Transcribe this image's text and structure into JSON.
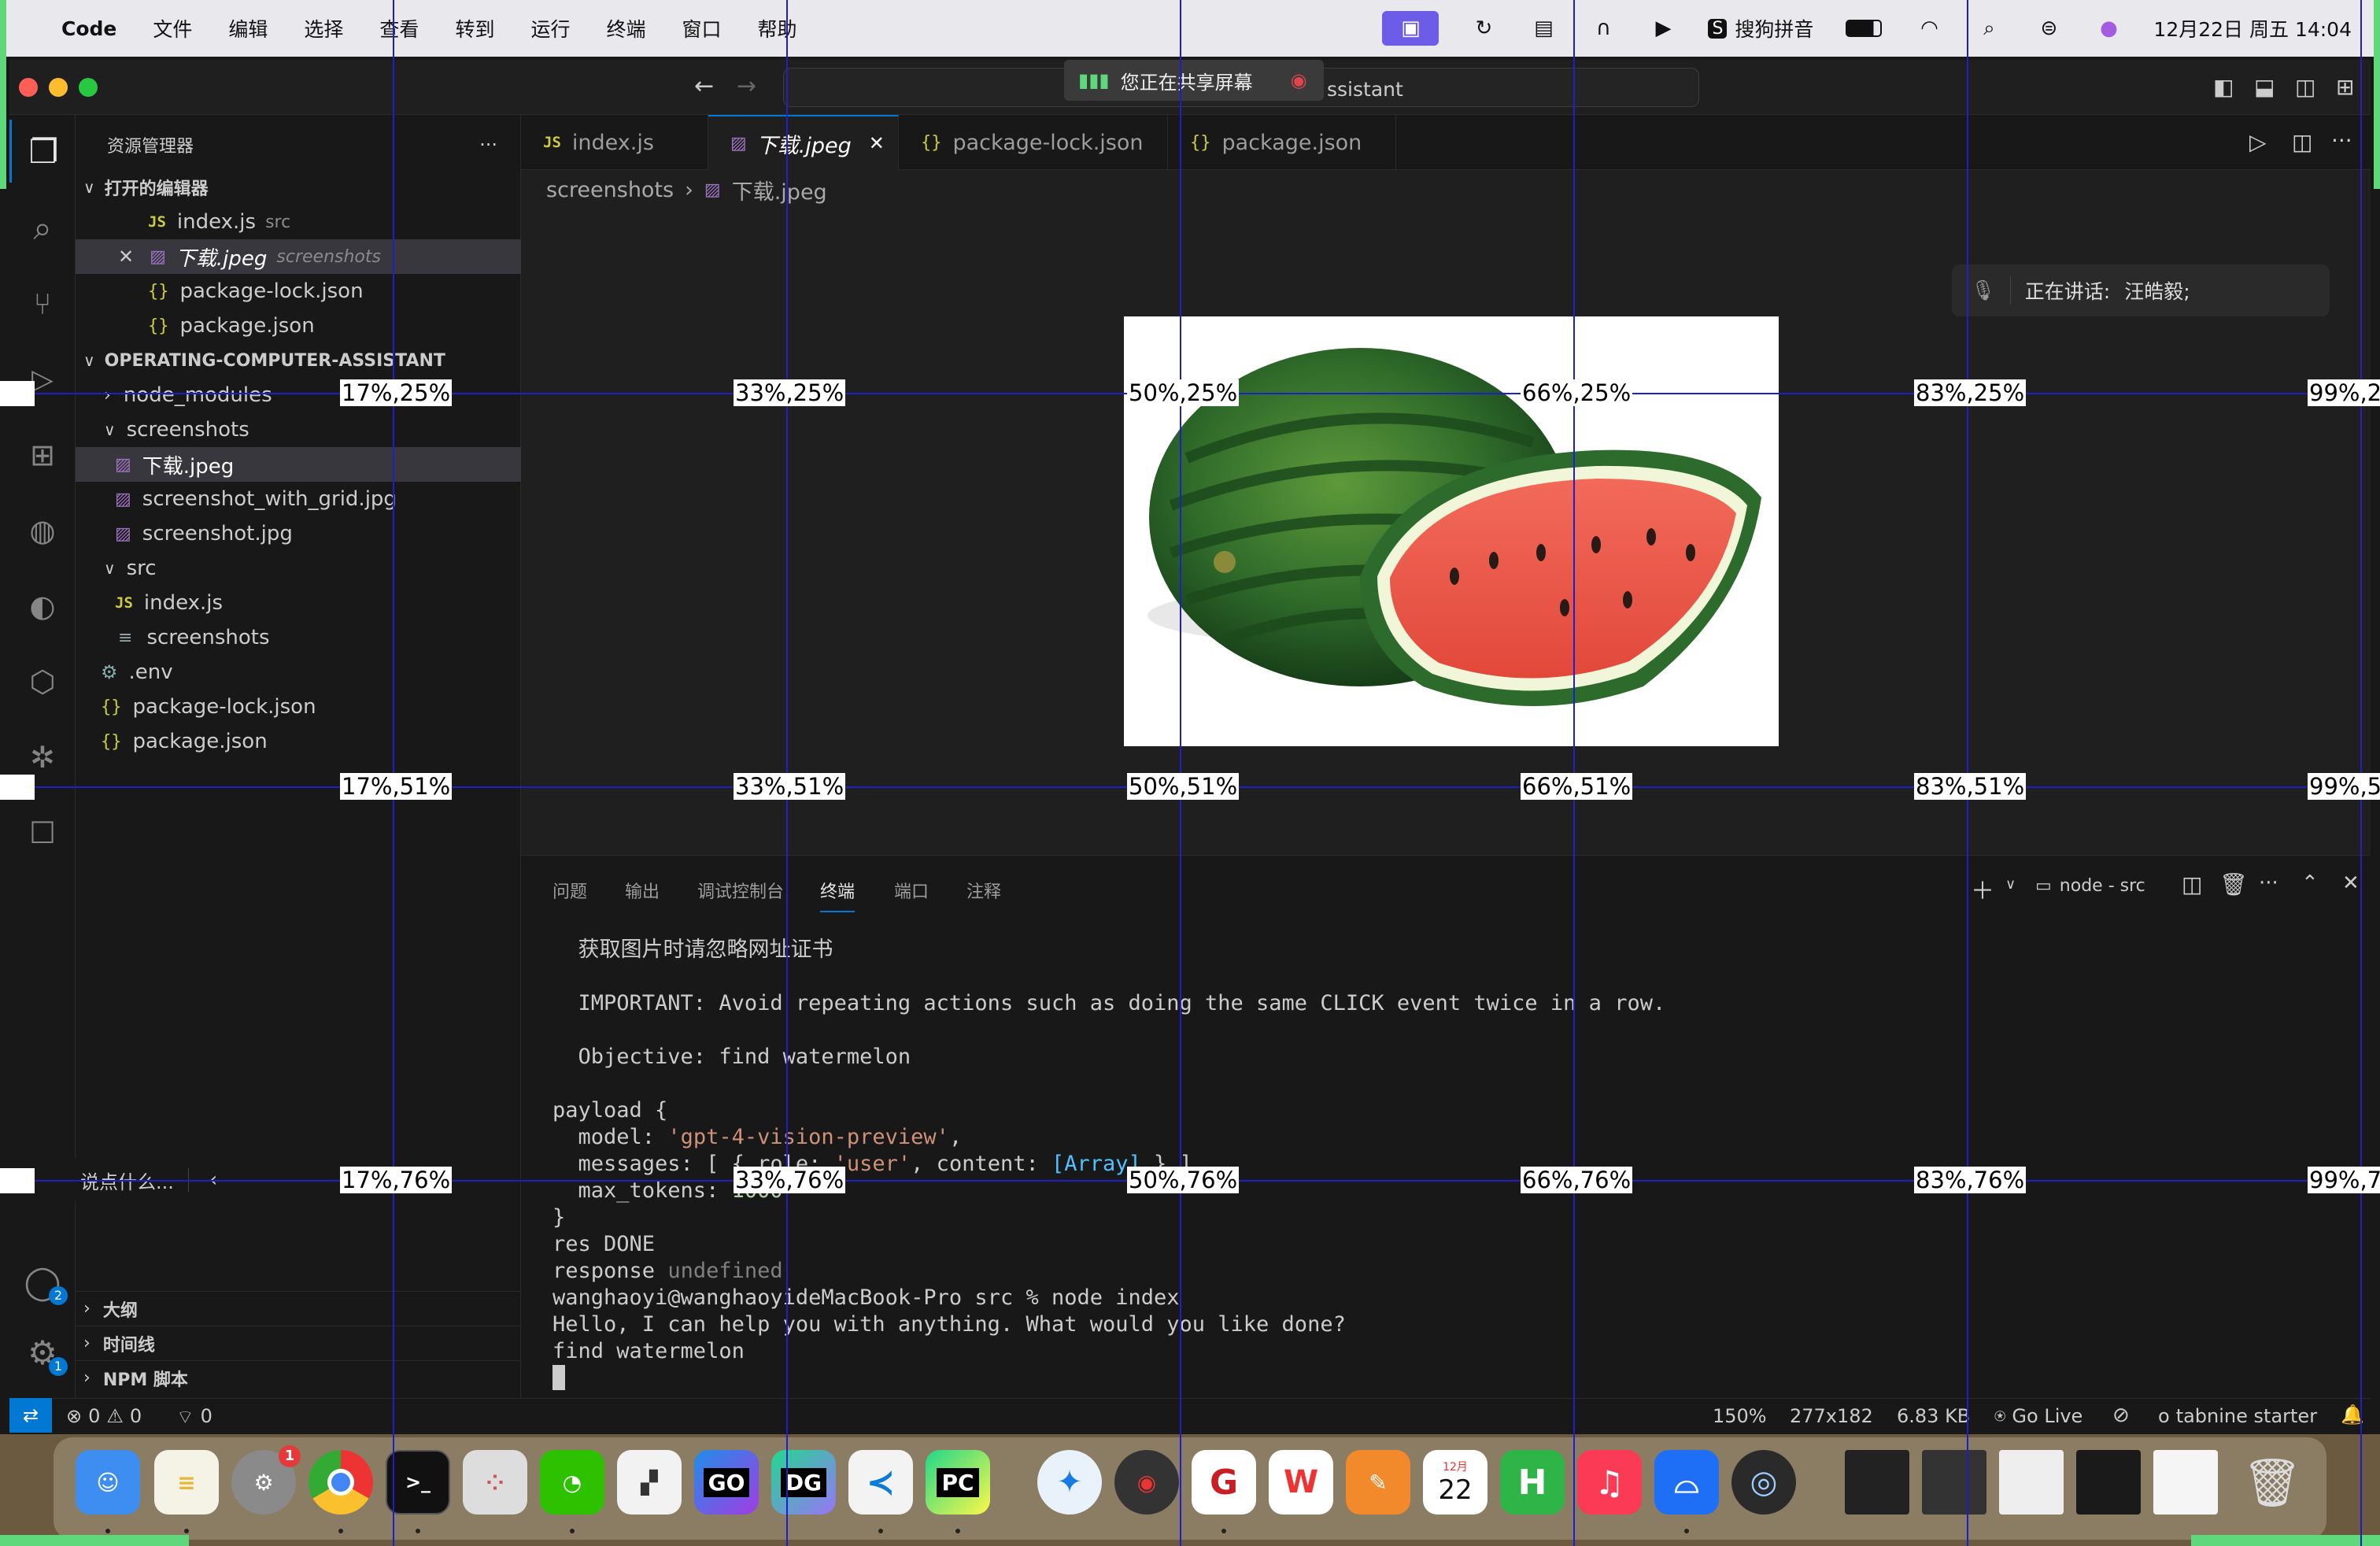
{
  "menubar": {
    "app": "Code",
    "items": [
      "文件",
      "编辑",
      "选择",
      "查看",
      "转到",
      "运行",
      "终端",
      "窗口",
      "帮助"
    ],
    "ime": "搜狗拼音",
    "datetime": "12月22日 周五 14:04"
  },
  "titlebar": {
    "search_text": "ssistant",
    "share_label": "您正在共享屏幕"
  },
  "sidebar": {
    "title": "资源管理器",
    "more": "···",
    "open_editors_header": "打开的编辑器",
    "open_editors": [
      {
        "name": "index.js",
        "hint": "src",
        "icon": "JS"
      },
      {
        "name": "下载.jpeg",
        "hint": "screenshots",
        "icon": "img"
      },
      {
        "name": "package-lock.json",
        "hint": "",
        "icon": "{}"
      },
      {
        "name": "package.json",
        "hint": "",
        "icon": "{}"
      }
    ],
    "project_header": "OPERATING-COMPUTER-ASSISTANT",
    "tree": [
      {
        "name": "node_modules",
        "icon": ">"
      },
      {
        "name": "screenshots",
        "icon": "v"
      },
      {
        "name": "下载.jpeg",
        "icon": "img"
      },
      {
        "name": "screenshot_with_grid.jpg",
        "icon": "img"
      },
      {
        "name": "screenshot.jpg",
        "icon": "img"
      },
      {
        "name": "src",
        "icon": "v"
      },
      {
        "name": "index.js",
        "icon": "JS"
      },
      {
        "name": "screenshots",
        "icon": "≡"
      },
      {
        "name": ".env",
        "icon": "⚙"
      },
      {
        "name": "package-lock.json",
        "icon": "{}"
      },
      {
        "name": "package.json",
        "icon": "{}"
      }
    ],
    "outline": "大纲",
    "timeline": "时间线",
    "npm": "NPM 脚本",
    "chat_placeholder": "说点什么..."
  },
  "tabs": [
    {
      "label": "index.js",
      "icon": "JS"
    },
    {
      "label": "下载.jpeg",
      "icon": "img",
      "active": true
    },
    {
      "label": "package-lock.json",
      "icon": "{}"
    },
    {
      "label": "package.json",
      "icon": "{}"
    }
  ],
  "breadcrumb": {
    "folder": "screenshots",
    "file": "下载.jpeg"
  },
  "voice": {
    "label": "正在讲话:",
    "name": "汪皓毅;"
  },
  "panel": {
    "tabs": [
      "问题",
      "输出",
      "调试控制台",
      "终端",
      "端口",
      "注释"
    ],
    "active_tab": "终端",
    "terminal_name": "node - src"
  },
  "terminal": {
    "line1": "  获取图片时请忽略网址证书",
    "line2": "  IMPORTANT: Avoid repeating actions such as doing the same CLICK event twice in a row.",
    "line3": "  Objective: find watermelon",
    "payload_open": "payload {",
    "model_key": "  model: ",
    "model_val": "'gpt-4-vision-preview'",
    "messages_key": "  messages: [ { role: ",
    "messages_role": "'user'",
    "messages_mid": ", content: ",
    "messages_arr": "[Array]",
    "messages_end": " } ],",
    "max_key": "  max_tokens: ",
    "max_val": "1000",
    "close": "}",
    "res": "res DONE",
    "response_key": "response ",
    "response_val": "undefined",
    "prompt": "wanghaoyi@wanghaoyideMacBook-Pro src % node index",
    "hello": "Hello, I can help you with anything. What would you like done?",
    "input": "find watermelon"
  },
  "status": {
    "errors": "0",
    "warnings": "0",
    "ports": "0",
    "zoom": "150%",
    "dims": "277x182",
    "size": "6.83 KB",
    "golive": "Go Live",
    "tabnine": "tabnine starter"
  },
  "grid_labels": {
    "r1": [
      "17%,25%",
      "33%,25%",
      "50%,25%",
      "66%,25%",
      "83%,25%",
      "99%,2"
    ],
    "r2": [
      "17%,51%",
      "33%,51%",
      "50%,51%",
      "66%,51%",
      "83%,51%",
      "99%,5"
    ],
    "r3": [
      "17%,76%",
      "33%,76%",
      "50%,76%",
      "66%,76%",
      "83%,76%",
      "99%,7"
    ]
  },
  "dock": {
    "calendar_month": "12月",
    "calendar_day": "22",
    "badge_settings": "1",
    "go_label": "GO",
    "dg_label": "DG",
    "pc_label": "PC",
    "h_label": "H",
    "account_badge": "2",
    "settings_badge": "1"
  }
}
